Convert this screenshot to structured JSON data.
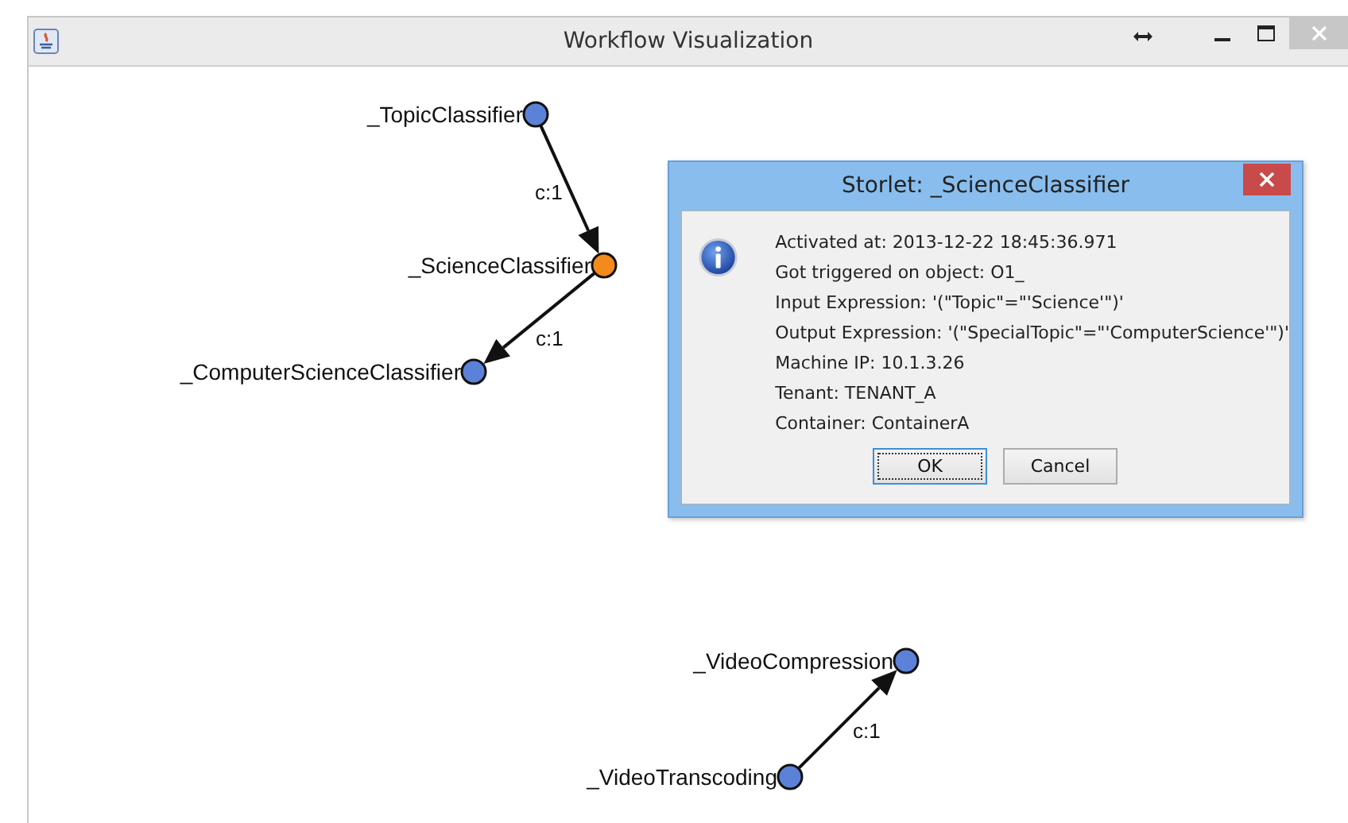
{
  "window": {
    "title": "Workflow Visualization"
  },
  "graph": {
    "nodes": [
      {
        "name": "_TopicClassifier",
        "color": "#5b82d8"
      },
      {
        "name": "_ScienceClassifier",
        "color": "#f28a1c"
      },
      {
        "name": "_ComputerScienceClassifier",
        "color": "#5b82d8"
      },
      {
        "name": "_VideoCompression",
        "color": "#5b82d8"
      },
      {
        "name": "_VideoTranscoding",
        "color": "#5b82d8"
      }
    ],
    "edges": [
      {
        "label": "c:1"
      },
      {
        "label": "c:1"
      },
      {
        "label": "c:1"
      }
    ]
  },
  "dialog": {
    "title": "Storlet: _ScienceClassifier",
    "lines": [
      "Activated at: 2013-12-22 18:45:36.971",
      "Got triggered on object: O1_",
      "Input Expression: '(\"Topic\"=\"'Science'\")'",
      "Output Expression: '(\"SpecialTopic\"=\"'ComputerScience'\")'",
      "Machine IP: 10.1.3.26",
      "Tenant: TENANT_A",
      "Container: ContainerA"
    ],
    "buttons": [
      {
        "label": "OK",
        "selected": true
      },
      {
        "label": "Cancel",
        "selected": false
      }
    ]
  }
}
